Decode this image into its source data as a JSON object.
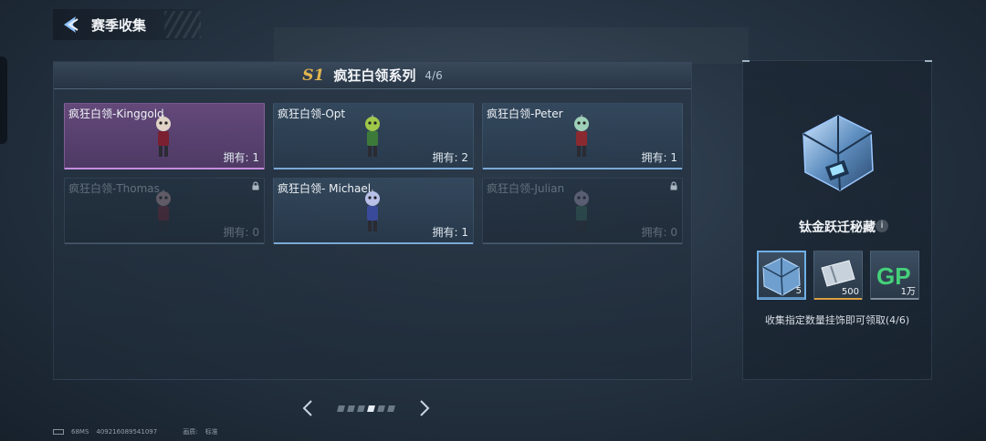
{
  "header": {
    "title": "赛季收集"
  },
  "series": {
    "badge": "S1",
    "name": "疯狂白领系列",
    "progress": "4/6"
  },
  "cards": [
    {
      "name": "疯狂白领-Kinggold",
      "own": "拥有: 1",
      "state": "selected",
      "body": "#7a2030",
      "head": "#e0d4c8"
    },
    {
      "name": "疯狂白领-Opt",
      "own": "拥有: 2",
      "state": "owned",
      "body": "#3c7a3a",
      "head": "#9fc84a"
    },
    {
      "name": "疯狂白领-Peter",
      "own": "拥有: 1",
      "state": "owned",
      "body": "#8a2a30",
      "head": "#9fd0b8"
    },
    {
      "name": "疯狂白领-Thomas",
      "own": "拥有: 0",
      "state": "locked",
      "body": "#7a2535",
      "head": "#d0a8b0"
    },
    {
      "name": "疯狂白领- Michael",
      "own": "拥有: 1",
      "state": "owned",
      "body": "#3a4a9a",
      "head": "#b8c0e8"
    },
    {
      "name": "疯狂白领-Julian",
      "own": "拥有: 0",
      "state": "locked",
      "body": "#3a7060",
      "head": "#c0b0d0"
    }
  ],
  "pager": {
    "total": 6,
    "active": 4
  },
  "reward": {
    "title": "钛金跃迁秘藏",
    "info": "i",
    "items": [
      {
        "icon": "chest-icon",
        "qty": "5",
        "underline": "#5e8fbf"
      },
      {
        "icon": "ticket-icon",
        "qty": "500",
        "underline": "#d9a040"
      },
      {
        "icon": "gp-icon",
        "qty": "1万",
        "underline": "#7f8c99"
      }
    ],
    "desc": "收集指定数量挂饰即可领取(4/6)"
  },
  "footer": {
    "ping": "68MS",
    "uid": "409216089541097",
    "quality_label": "画质:",
    "quality_value": "标准"
  }
}
